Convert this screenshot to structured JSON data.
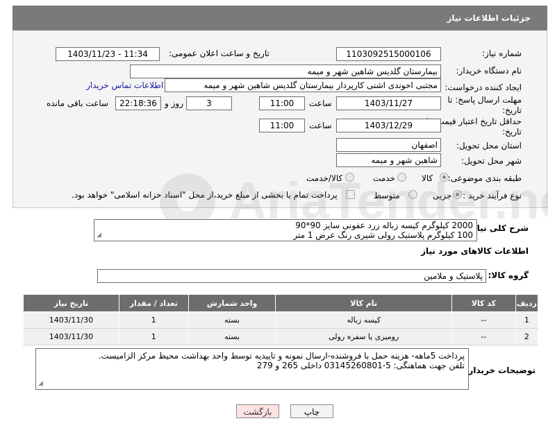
{
  "header": {
    "title": "جزئیات اطلاعات نیاز"
  },
  "fields": {
    "need_number_label": "شماره نیاز:",
    "need_number": "1103092515000106",
    "announce_label": "تاریخ و ساعت اعلان عمومی:",
    "announce_value": "1403/11/23 - 11:34",
    "buyer_org_label": "نام دستگاه خریدار:",
    "buyer_org": "بیمارستان گلدیس  شاهین شهر و میمه",
    "requester_label": "ایجاد کننده درخواست:",
    "requester": "مجتبی اخوندی اشنی کارپرداز بیمارستان گلدیس  شاهین شهر و میمه",
    "contact_link": "اطلاعات تماس خریدار",
    "deadline_label_1": "مهلت ارسال پاسخ: تا",
    "deadline_label_2": "تاریخ:",
    "deadline_date": "1403/11/27",
    "time_label": "ساعت",
    "deadline_time": "11:00",
    "days_value": "3",
    "days_label": "روز و",
    "remaining_time": "22:18:36",
    "remaining_label": "ساعت باقی مانده",
    "validity_label_1": "حداقل تاریخ اعتبار قیمت: تا",
    "validity_label_2": "تاریخ:",
    "validity_date": "1403/12/29",
    "validity_time": "11:00",
    "province_label": "استان محل تحویل:",
    "province": "اصفهان",
    "city_label": "شهر محل تحویل:",
    "city": "شاهین شهر و میمه",
    "category_label": "طبقه بندی موضوعی:",
    "category_options": [
      "کالا",
      "خدمت",
      "کالا/خدمت"
    ],
    "process_label": "نوع فرآیند خرید :",
    "process_options": [
      "جزیی",
      "متوسط"
    ],
    "payment_note": "پرداخت تمام یا بخشی از مبلغ خرید،از محل \"اسناد خزانه اسلامی\" خواهد بود."
  },
  "description": {
    "label": "شرح کلی نیاز:",
    "line1": "2000 کیلوگرم کیسه زباله زرد عفونی سایز 90*90",
    "line2": "100 کیلوگرم پلاستیک رولی شیری رنگ عرض 1 متر"
  },
  "goods_info": {
    "title": "اطلاعات کالاهای مورد نیاز",
    "group_label": "گروه کالا:",
    "group_value": "پلاستیک و ملامین"
  },
  "table": {
    "headers": [
      "ردیف",
      "کد کالا",
      "نام کالا",
      "واحد شمارش",
      "تعداد / مقدار",
      "تاریخ نیاز"
    ],
    "rows": [
      [
        "1",
        "--",
        "کیسه زباله",
        "بسته",
        "1",
        "1403/11/30"
      ],
      [
        "2",
        "--",
        "رومیزی یا سفره رولی",
        "بسته",
        "1",
        "1403/11/30"
      ]
    ]
  },
  "buyer_notes": {
    "label": "توضیحات خریدار:",
    "line1": "پرداخت 5ماهه- هزینه حمل با فروشنده-ارسال نمونه و تاییدیه توسط واحد بهداشت محیط مرکز الزامیست.",
    "line2": "تلفن جهت هماهنگی: 5-03145260801 داخلی 265 و 279"
  },
  "buttons": {
    "print": "چاپ",
    "back": "بازگشت"
  },
  "watermark": {
    "text": "AriaTender.neT"
  },
  "colors": {
    "header_bg": "#7a7a7a",
    "table_header_bg": "#6d6d6d",
    "link": "#1a1aa6",
    "back_button_bg": "#fbe3e3"
  }
}
